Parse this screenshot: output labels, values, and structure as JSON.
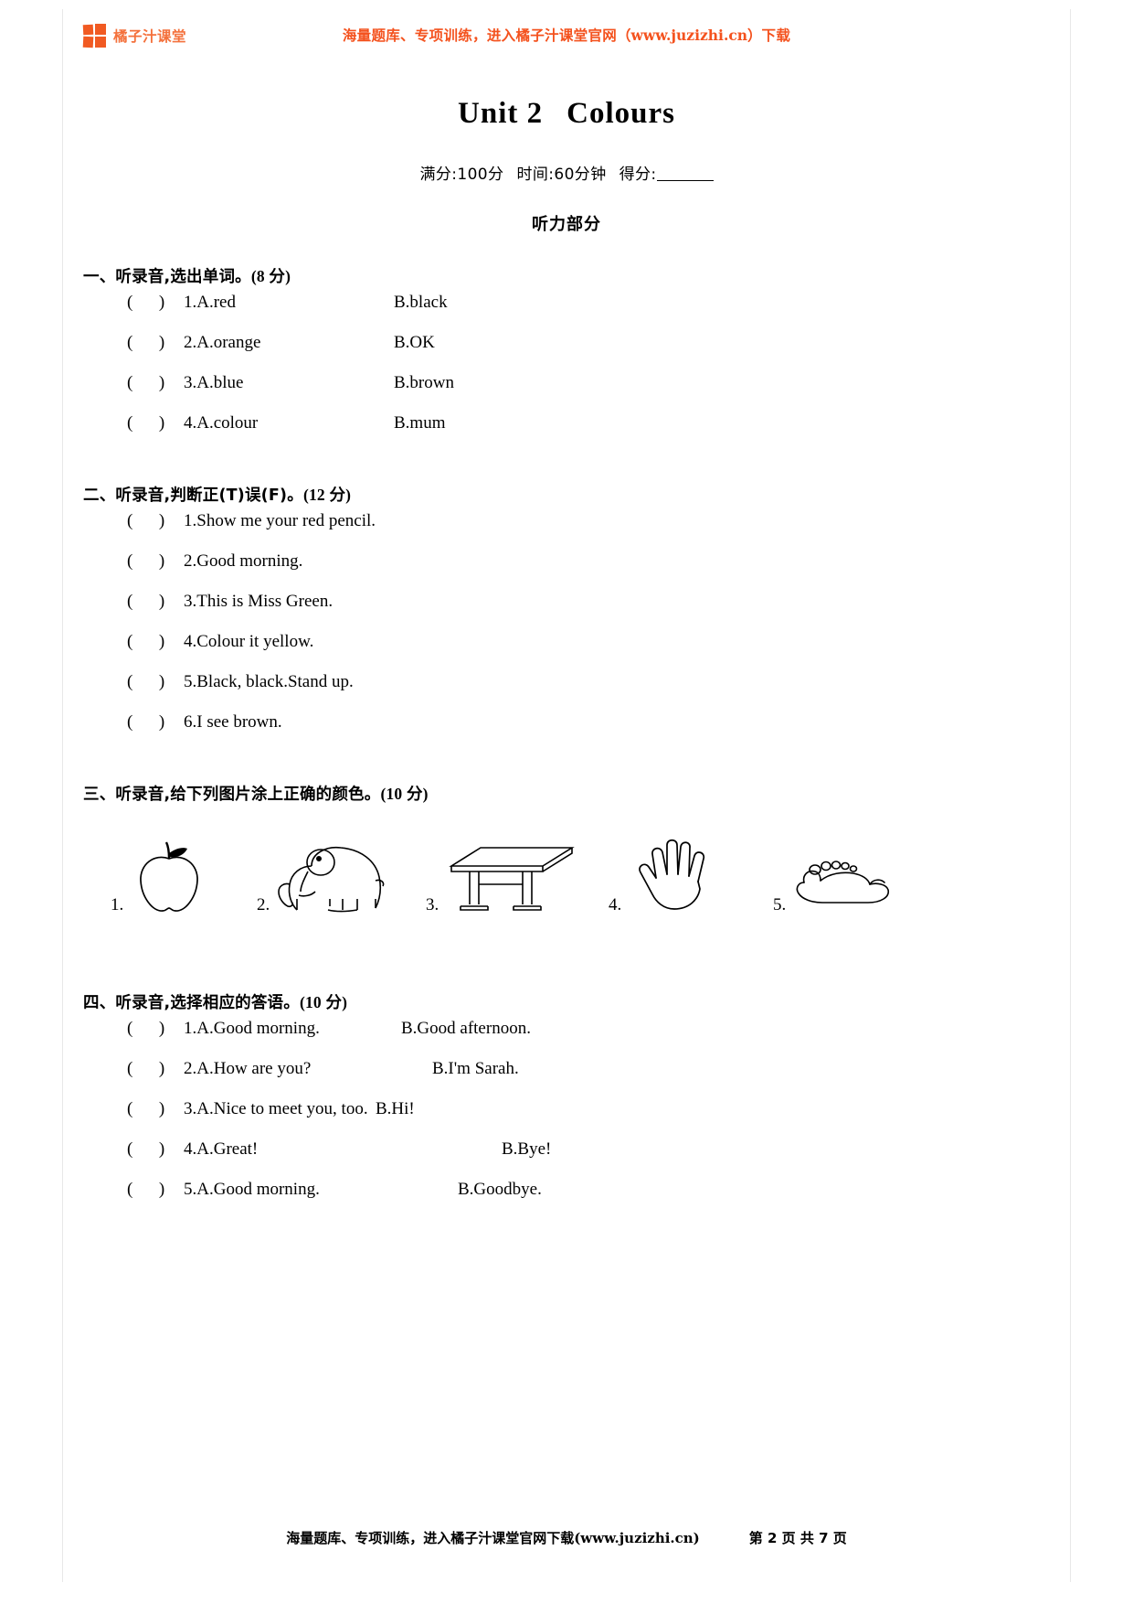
{
  "header": {
    "brand_name": "橘子汁课堂",
    "promo_prefix": "海量题库、专项训练，进入橘子汁课堂官网",
    "promo_url": "（www.juzizhi.cn）",
    "promo_suffix": "下载",
    "accent_color": "#f4521e",
    "logo_color": "#f15a22"
  },
  "title": {
    "unit": "Unit 2",
    "name": "Colours"
  },
  "meta": {
    "full_score": "满分:100分",
    "time": "时间:60分钟",
    "score_label": "得分:",
    "part_title": "听力部分"
  },
  "sections": [
    {
      "heading": "一、听录音,选出单词。",
      "points": "(8 分)",
      "questions": [
        {
          "paren": "(      )",
          "a": "1.A.red",
          "b": "B.black"
        },
        {
          "paren": "(      )",
          "a": "2.A.orange",
          "b": "B.OK"
        },
        {
          "paren": "(      )",
          "a": "3.A.blue",
          "b": "B.brown"
        },
        {
          "paren": "(      )",
          "a": "4.A.colour",
          "b": "B.mum"
        }
      ]
    },
    {
      "heading": "二、听录音,判断正(T)误(F)。",
      "points": "(12 分)",
      "questions": [
        {
          "paren": "(      )",
          "a": "1.Show me your red pencil.",
          "b": ""
        },
        {
          "paren": "(      )",
          "a": "2.Good morning.",
          "b": ""
        },
        {
          "paren": "(      )",
          "a": "3.This is Miss Green.",
          "b": ""
        },
        {
          "paren": "(      )",
          "a": "4.Colour it yellow.",
          "b": ""
        },
        {
          "paren": "(      )",
          "a": "5.Black, black.Stand up.",
          "b": ""
        },
        {
          "paren": "(      )",
          "a": "6.I see brown.",
          "b": ""
        }
      ]
    },
    {
      "heading": "三、听录音,给下列图片涂上正确的颜色。",
      "points": "(10 分)",
      "pictures": [
        {
          "num": "1.",
          "icon": "apple-icon"
        },
        {
          "num": "2.",
          "icon": "elephant-icon"
        },
        {
          "num": "3.",
          "icon": "desk-icon"
        },
        {
          "num": "4.",
          "icon": "hand-icon"
        },
        {
          "num": "5.",
          "icon": "foot-icon"
        }
      ]
    },
    {
      "heading": "四、听录音,选择相应的答语。",
      "points": "(10 分)",
      "questions": [
        {
          "paren": "(      )",
          "a": "1.A.Good morning.",
          "b": "B.Good afternoon."
        },
        {
          "paren": "(      )",
          "a": "2.A.How are you?",
          "b": "B.I'm Sarah."
        },
        {
          "paren": "(      )",
          "a": "3.A.Nice to meet you, too.",
          "b": "B.Hi!"
        },
        {
          "paren": "(      )",
          "a": "4.A.Great!",
          "b": "B.Bye!"
        },
        {
          "paren": "(      )",
          "a": "5.A.Good morning.",
          "b": "B.Goodbye."
        }
      ]
    }
  ],
  "footer": {
    "note": "海量题库、专项训练，进入橘子汁课堂官网下载(www.juzizhi.cn)",
    "page_number": "第 2 页 共 7 页"
  }
}
